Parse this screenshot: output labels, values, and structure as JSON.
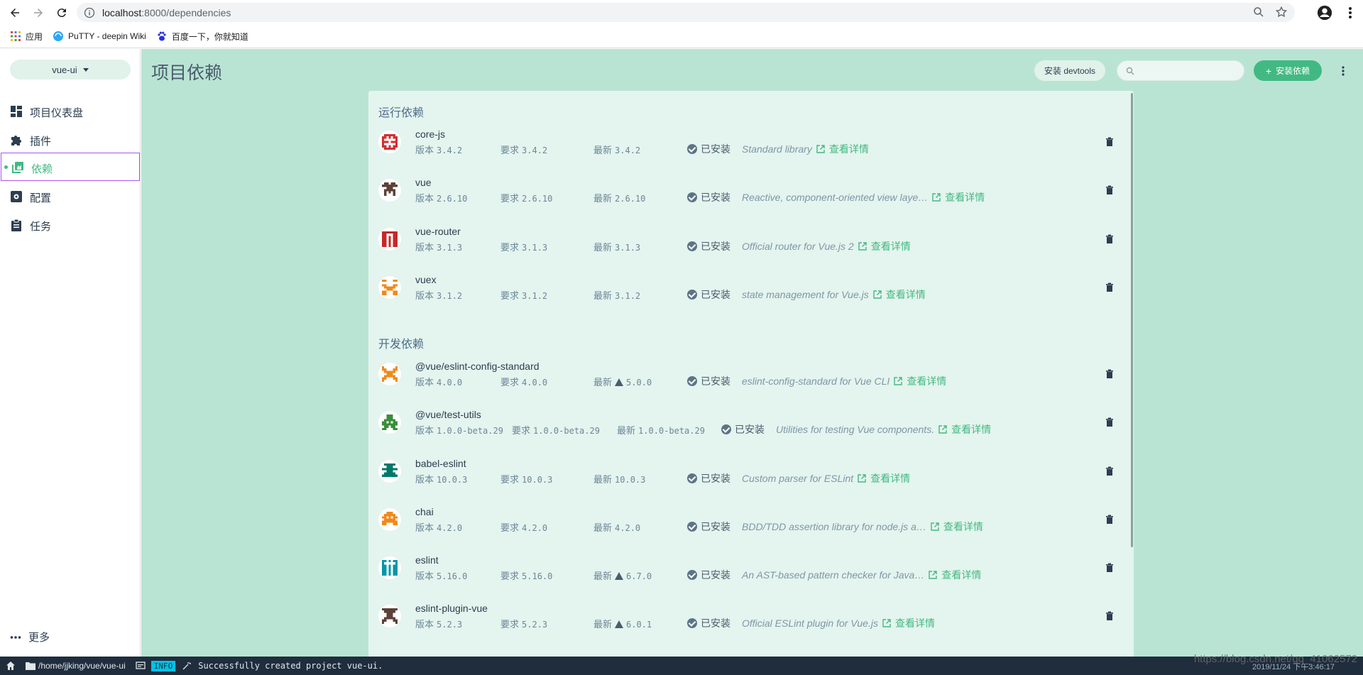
{
  "browser": {
    "url_host": "localhost",
    "url_path": ":8000/dependencies",
    "bookmarks": [
      {
        "label": "应用",
        "icon": "apps-grid-icon"
      },
      {
        "label": "PuTTY - deepin Wiki",
        "icon": "deepin-icon"
      },
      {
        "label": "百度一下，你就知道",
        "icon": "baidu-paw-icon"
      }
    ]
  },
  "sidebar": {
    "project": "vue-ui",
    "items": [
      {
        "label": "项目仪表盘",
        "icon": "dashboard-icon"
      },
      {
        "label": "插件",
        "icon": "puzzle-icon"
      },
      {
        "label": "依赖",
        "icon": "collections-icon",
        "active": true
      },
      {
        "label": "配置",
        "icon": "settings-icon"
      },
      {
        "label": "任务",
        "icon": "clipboard-icon"
      }
    ],
    "more_label": "更多"
  },
  "header": {
    "title": "项目依赖",
    "devtools_label": "安装 devtools",
    "search_placeholder": "",
    "install_label": "安装依赖"
  },
  "sections": {
    "runtime": "运行依赖",
    "dev": "开发依赖"
  },
  "labels": {
    "version": "版本",
    "required": "要求",
    "latest": "最新",
    "installed": "已安装",
    "details": "查看详情"
  },
  "deps": [
    {
      "name": "core-js",
      "version": "3.4.2",
      "required": "3.4.2",
      "latest": "3.4.2",
      "warn": false,
      "desc": "Standard library",
      "color": "#d32f2f"
    },
    {
      "name": "vue",
      "version": "2.6.10",
      "required": "2.6.10",
      "latest": "2.6.10",
      "warn": false,
      "desc": "Reactive, component-oriented view laye…",
      "color": "#5d4037"
    },
    {
      "name": "vue-router",
      "version": "3.1.3",
      "required": "3.1.3",
      "latest": "3.1.3",
      "warn": false,
      "desc": "Official router for Vue.js 2",
      "color": "#c62828"
    },
    {
      "name": "vuex",
      "version": "3.1.2",
      "required": "3.1.2",
      "latest": "3.1.2",
      "warn": false,
      "desc": "state management for Vue.js",
      "color": "#ef8a1c"
    },
    {
      "name": "@vue/eslint-config-standard",
      "version": "4.0.0",
      "required": "4.0.0",
      "latest": "5.0.0",
      "warn": true,
      "desc": "eslint-config-standard for Vue CLI",
      "color": "#ef8a1c"
    },
    {
      "name": "@vue/test-utils",
      "version": "1.0.0-beta.29",
      "required": "1.0.0-beta.29",
      "latest": "1.0.0-beta.29",
      "warn": false,
      "desc": "Utilities for testing Vue components.",
      "color": "#388e3c"
    },
    {
      "name": "babel-eslint",
      "version": "10.0.3",
      "required": "10.0.3",
      "latest": "10.0.3",
      "warn": false,
      "desc": "Custom parser for ESLint",
      "color": "#00796b"
    },
    {
      "name": "chai",
      "version": "4.2.0",
      "required": "4.2.0",
      "latest": "4.2.0",
      "warn": false,
      "desc": "BDD/TDD assertion library for node.js a…",
      "color": "#ef8a1c"
    },
    {
      "name": "eslint",
      "version": "5.16.0",
      "required": "5.16.0",
      "latest": "6.7.0",
      "warn": true,
      "desc": "An AST-based pattern checker for Java…",
      "color": "#0097a7"
    },
    {
      "name": "eslint-plugin-vue",
      "version": "5.2.3",
      "required": "5.2.3",
      "latest": "6.0.1",
      "warn": true,
      "desc": "Official ESLint plugin for Vue.js",
      "color": "#5d4037"
    }
  ],
  "status": {
    "path": "/home/jjking/vue/vue-ui",
    "level": "INFO",
    "message": "Successfully created project vue-ui.",
    "time": "2019/11/24 下午3:46:17"
  },
  "watermark": "https://blog.csdn.net/qq_41062572"
}
